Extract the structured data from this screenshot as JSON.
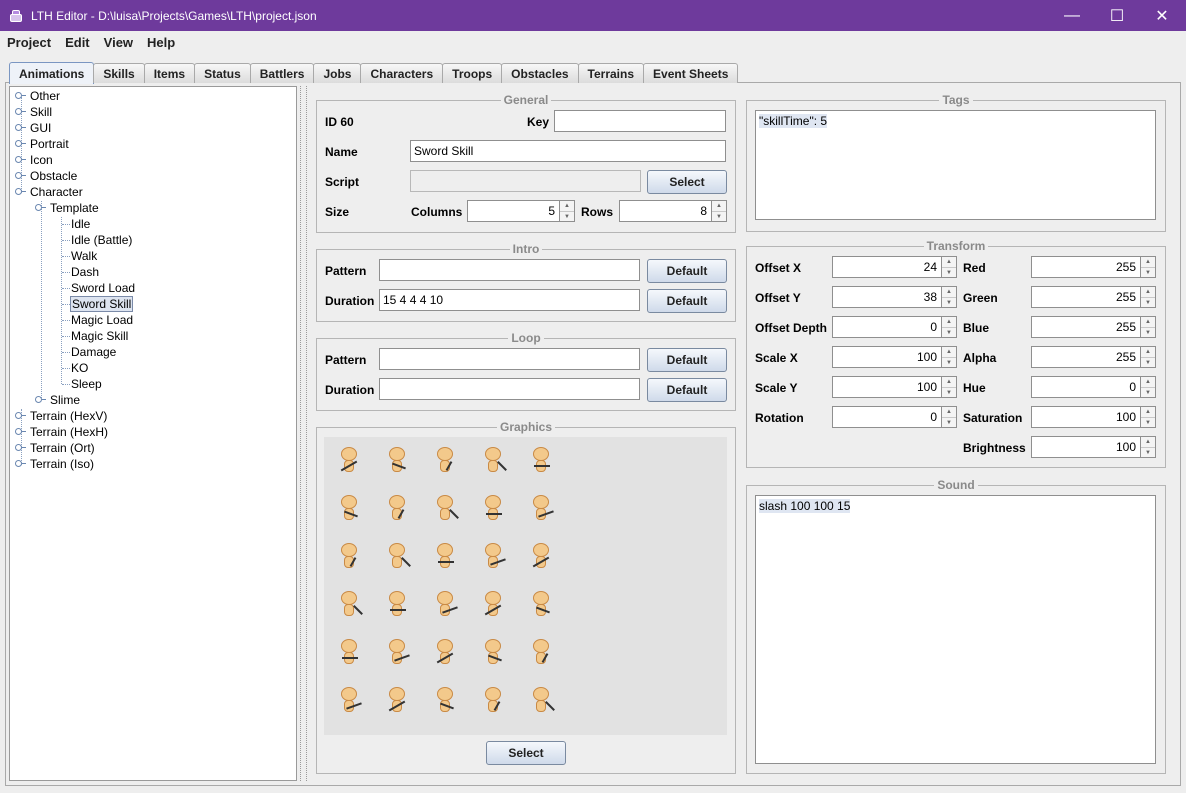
{
  "window": {
    "title": "LTH Editor - D:\\luisa\\Projects\\Games\\LTH\\project.json",
    "minimize": "—",
    "maximize": "☐",
    "close": "✕"
  },
  "menu": [
    "Project",
    "Edit",
    "View",
    "Help"
  ],
  "tabs": [
    "Animations",
    "Skills",
    "Items",
    "Status",
    "Battlers",
    "Jobs",
    "Characters",
    "Troops",
    "Obstacles",
    "Terrains",
    "Event Sheets"
  ],
  "tree": {
    "root_items": [
      "Other",
      "Skill",
      "GUI",
      "Portrait",
      "Icon",
      "Obstacle",
      "Character"
    ],
    "template": "Template",
    "template_children": [
      "Idle",
      "Idle (Battle)",
      "Walk",
      "Dash",
      "Sword Load",
      "Sword Skill",
      "Magic Load",
      "Magic Skill",
      "Damage",
      "KO",
      "Sleep"
    ],
    "slime": "Slime",
    "terrain_items": [
      "Terrain (HexV)",
      "Terrain (HexH)",
      "Terrain (Ort)",
      "Terrain (Iso)"
    ],
    "selected": "Sword Skill"
  },
  "general": {
    "legend": "General",
    "id": "ID 60",
    "key_label": "Key",
    "key_value": "",
    "name_label": "Name",
    "name_value": "Sword Skill",
    "script_label": "Script",
    "script_value": "",
    "select_label": "Select",
    "size_label": "Size",
    "columns_label": "Columns",
    "columns_value": "5",
    "rows_label": "Rows",
    "rows_value": "8"
  },
  "intro": {
    "legend": "Intro",
    "pattern_label": "Pattern",
    "pattern_value": "",
    "duration_label": "Duration",
    "duration_value": "15 4 4 4 10",
    "default_label": "Default"
  },
  "loop": {
    "legend": "Loop",
    "pattern_label": "Pattern",
    "pattern_value": "",
    "duration_label": "Duration",
    "duration_value": "",
    "default_label": "Default"
  },
  "graphics": {
    "legend": "Graphics",
    "select_label": "Select"
  },
  "tags": {
    "legend": "Tags",
    "text": "\"skillTime\": 5"
  },
  "transform": {
    "legend": "Transform",
    "left": [
      {
        "label": "Offset X",
        "value": "24"
      },
      {
        "label": "Offset Y",
        "value": "38"
      },
      {
        "label": "Offset Depth",
        "value": "0"
      },
      {
        "label": "Scale X",
        "value": "100"
      },
      {
        "label": "Scale Y",
        "value": "100"
      },
      {
        "label": "Rotation",
        "value": "0"
      }
    ],
    "right": [
      {
        "label": "Red",
        "value": "255"
      },
      {
        "label": "Green",
        "value": "255"
      },
      {
        "label": "Blue",
        "value": "255"
      },
      {
        "label": "Alpha",
        "value": "255"
      },
      {
        "label": "Hue",
        "value": "0"
      },
      {
        "label": "Saturation",
        "value": "100"
      },
      {
        "label": "Brightness",
        "value": "100"
      }
    ]
  },
  "sound": {
    "legend": "Sound",
    "text": "slash 100 100 15"
  },
  "colors": {
    "titlebar": "#6e3a9c",
    "selection": "#dde4f0"
  }
}
